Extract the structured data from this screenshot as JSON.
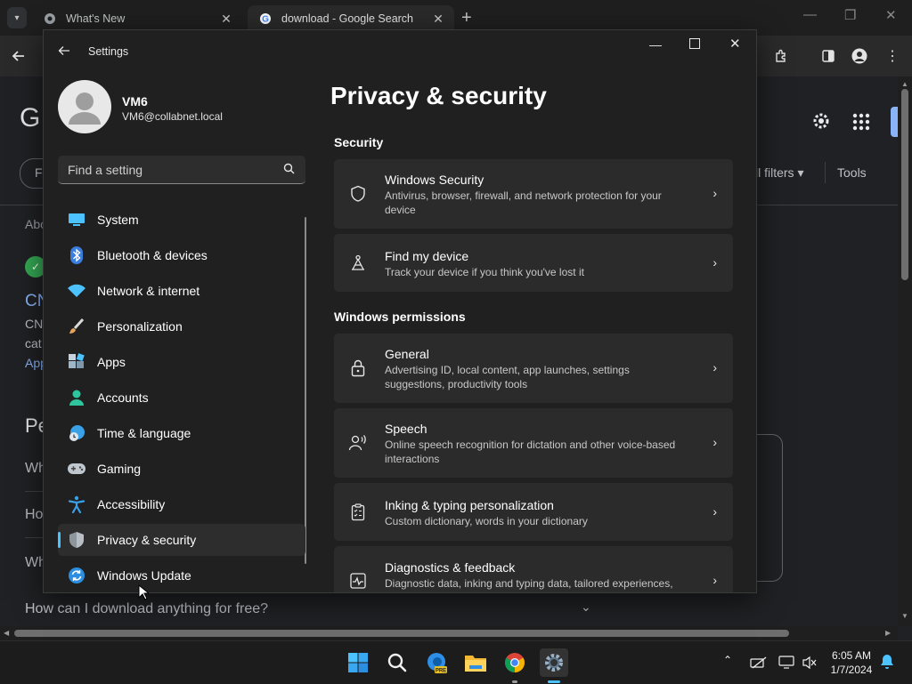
{
  "browser": {
    "tabs": [
      {
        "title": "What's New",
        "active": false
      },
      {
        "title": "download - Google Search",
        "active": true
      }
    ],
    "new_tab": "+",
    "window_controls": [
      "—",
      "❐",
      "✕"
    ]
  },
  "google_page": {
    "logo_letter": "G",
    "filter_chip": "F",
    "all_filters": "ll filters",
    "tools": "Tools",
    "about": "Abo",
    "result_title": "CN",
    "result_lines": [
      "CN",
      "cat",
      "App"
    ],
    "people_heading": "Pe",
    "faq_partial": [
      "Wh",
      "Ho",
      "Wh"
    ],
    "faq_bottom": "How can I download anything for free?"
  },
  "settings": {
    "title": "Settings",
    "user": {
      "name": "VM6",
      "email": "VM6@collabnet.local"
    },
    "search_placeholder": "Find a setting",
    "nav": [
      {
        "label": "System",
        "icon": "system-icon",
        "selected": false
      },
      {
        "label": "Bluetooth & devices",
        "icon": "bluetooth-icon",
        "selected": false
      },
      {
        "label": "Network & internet",
        "icon": "wifi-icon",
        "selected": false
      },
      {
        "label": "Personalization",
        "icon": "brush-icon",
        "selected": false
      },
      {
        "label": "Apps",
        "icon": "apps-icon",
        "selected": false
      },
      {
        "label": "Accounts",
        "icon": "accounts-icon",
        "selected": false
      },
      {
        "label": "Time & language",
        "icon": "clock-globe-icon",
        "selected": false
      },
      {
        "label": "Gaming",
        "icon": "gamepad-icon",
        "selected": false
      },
      {
        "label": "Accessibility",
        "icon": "accessibility-icon",
        "selected": false
      },
      {
        "label": "Privacy & security",
        "icon": "shield-icon",
        "selected": true
      },
      {
        "label": "Windows Update",
        "icon": "update-icon",
        "selected": false
      }
    ],
    "page_title": "Privacy & security",
    "sections": [
      {
        "heading": "Security",
        "cards": [
          {
            "title": "Windows Security",
            "desc": "Antivirus, browser, firewall, and network protection for your device",
            "icon": "shield-outline-icon"
          },
          {
            "title": "Find my device",
            "desc": "Track your device if you think you've lost it",
            "icon": "find-device-icon"
          }
        ]
      },
      {
        "heading": "Windows permissions",
        "cards": [
          {
            "title": "General",
            "desc": "Advertising ID, local content, app launches, settings suggestions, productivity tools",
            "icon": "lock-icon"
          },
          {
            "title": "Speech",
            "desc": "Online speech recognition for dictation and other voice-based interactions",
            "icon": "speech-icon"
          },
          {
            "title": "Inking & typing personalization",
            "desc": "Custom dictionary, words in your dictionary",
            "icon": "clipboard-icon"
          },
          {
            "title": "Diagnostics & feedback",
            "desc": "Diagnostic data, inking and typing data, tailored experiences,",
            "icon": "diagnostics-icon"
          }
        ]
      }
    ]
  },
  "taskbar": {
    "time": "6:05 AM",
    "date": "1/7/2024",
    "edge_badge": "PRE"
  },
  "colors": {
    "accent": "#4cc2ff",
    "window_bg": "#202020",
    "card_bg": "#2b2b2b"
  }
}
